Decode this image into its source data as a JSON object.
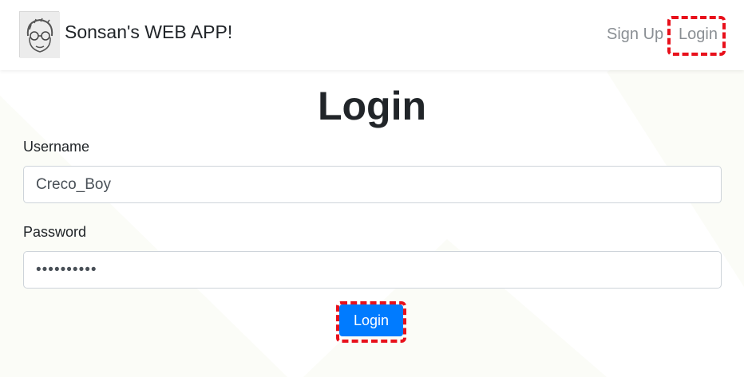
{
  "navbar": {
    "brand": "Sonsan's WEB APP!",
    "links": [
      {
        "label": "Sign Up",
        "icon": ""
      },
      {
        "label": "Login",
        "icon": ""
      }
    ]
  },
  "page": {
    "title": "Login"
  },
  "form": {
    "username_label": "Username",
    "username_value": "Creco_Boy",
    "password_label": "Password",
    "password_value": "••••••••••",
    "submit_label": "Login"
  },
  "colors": {
    "primary_button": "#007bff",
    "highlight_box": "#e8101b",
    "nav_link": "#8a8f94"
  },
  "icons": {
    "brand_logo": "avatar-cartoon-face-icon"
  }
}
